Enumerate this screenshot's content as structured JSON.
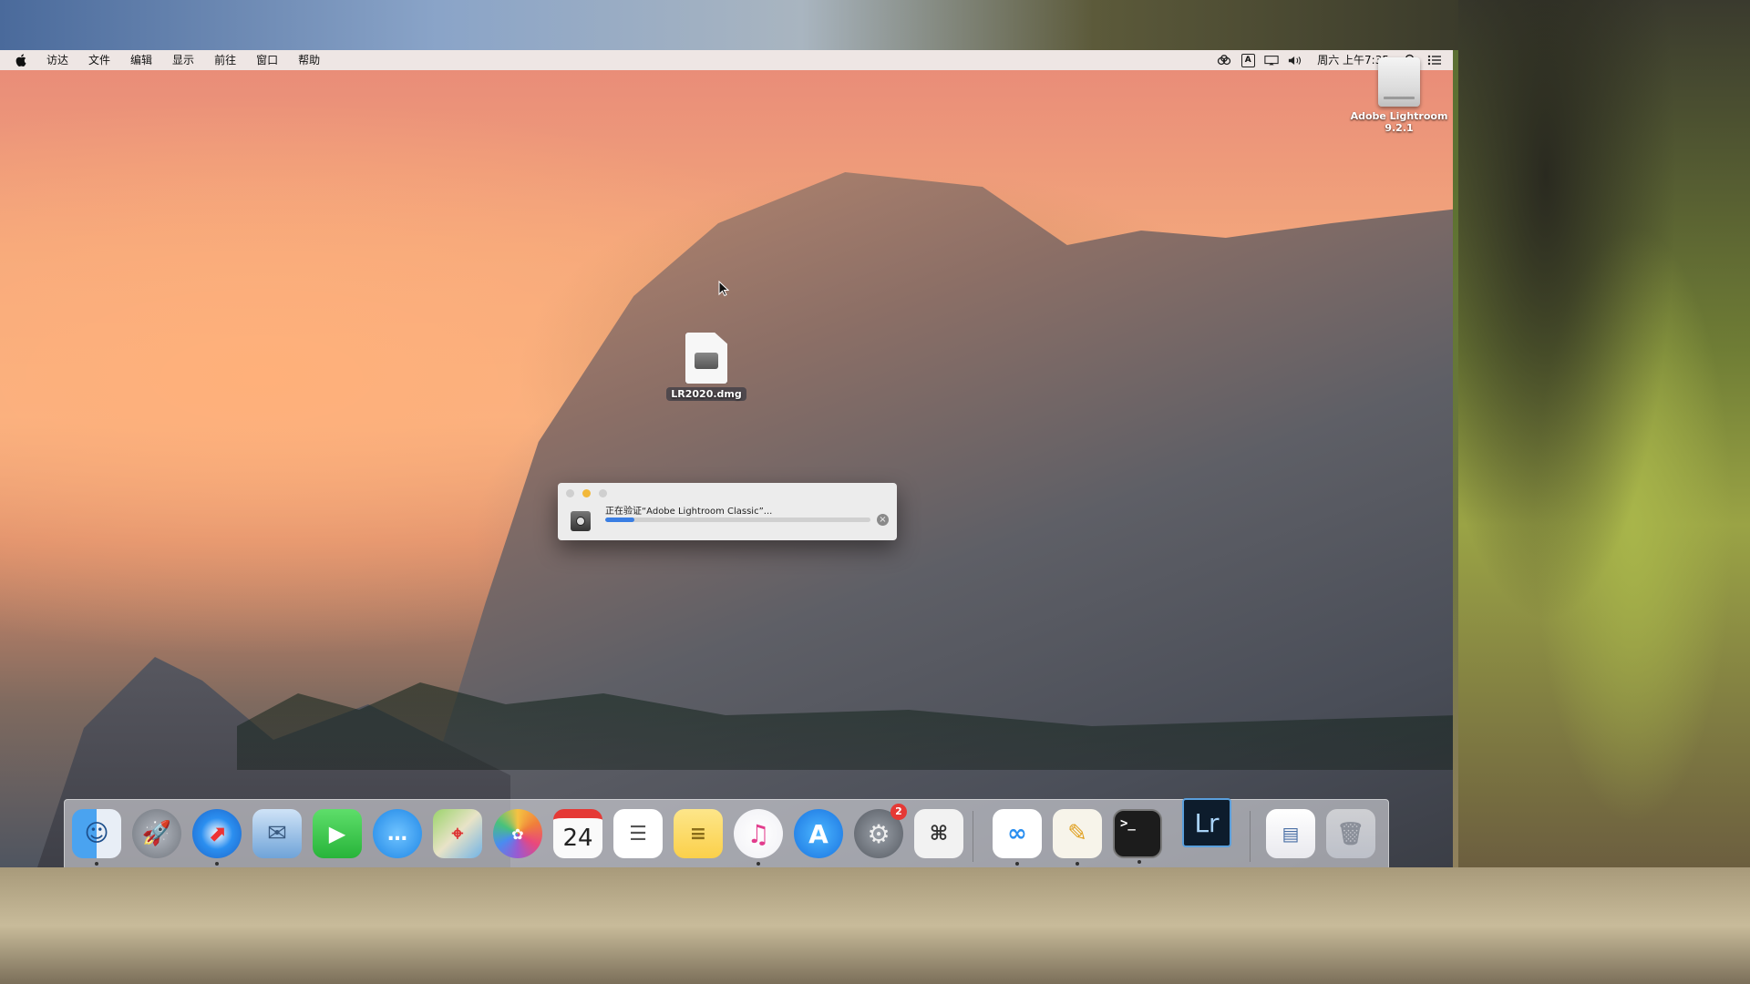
{
  "menubar": {
    "items": [
      "访达",
      "文件",
      "编辑",
      "显示",
      "前往",
      "窗口",
      "帮助"
    ],
    "status_icons": [
      "creative-cloud-icon",
      "input-source-icon",
      "airplay-display-icon",
      "volume-icon",
      "spotlight-search-icon",
      "notification-center-icon"
    ],
    "input_source": "A",
    "clock": "周六 上午7:35"
  },
  "desktop": {
    "drive": {
      "label_line1": "Adobe Lightroom",
      "label_line2": "9.2.1",
      "icon": "disk-image-volume-icon"
    },
    "dmg_file": {
      "label": "LR2020.dmg",
      "icon": "dmg-file-icon"
    }
  },
  "dialog": {
    "message": "正在验证“Adobe Lightroom Classic”...",
    "progress": 0.11,
    "colors": {
      "progress": "#3a7ee3",
      "minimize": "#f2b83a"
    }
  },
  "dock": {
    "apps": [
      {
        "name": "finder-icon"
      },
      {
        "name": "launchpad-icon"
      },
      {
        "name": "safari-icon"
      },
      {
        "name": "mail-icon"
      },
      {
        "name": "facetime-icon"
      },
      {
        "name": "messages-icon"
      },
      {
        "name": "maps-icon"
      },
      {
        "name": "photos-icon"
      },
      {
        "name": "calendar-icon",
        "text": "24"
      },
      {
        "name": "reminders-icon"
      },
      {
        "name": "notes-icon"
      },
      {
        "name": "itunes-icon"
      },
      {
        "name": "app-store-icon"
      },
      {
        "name": "system-preferences-icon",
        "badge": "2"
      },
      {
        "name": "screenshot-icon"
      },
      {
        "name": "baidu-netdisk-icon"
      },
      {
        "name": "script-editor-icon"
      },
      {
        "name": "terminal-icon",
        "text": ">_"
      },
      {
        "name": "lightroom-icon",
        "text": "Lr"
      },
      {
        "name": "documents-stack-icon"
      },
      {
        "name": "trash-icon"
      }
    ]
  }
}
